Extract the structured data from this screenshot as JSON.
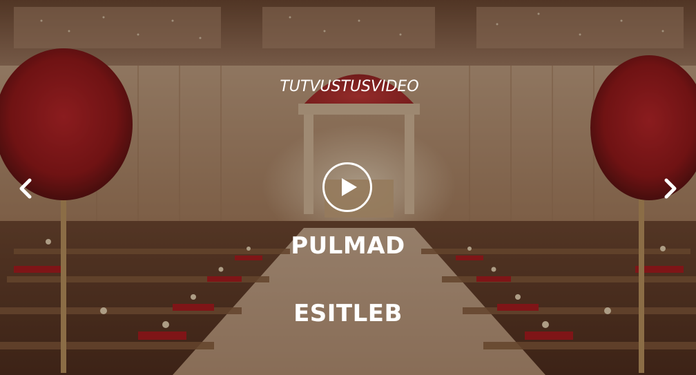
{
  "slide": {
    "eyebrow": "TUTVUSTUSVIDEO",
    "title": "PULMAD",
    "cta": "ESITLEB"
  },
  "controls": {
    "prev_icon": "chevron-left-icon",
    "next_icon": "chevron-right-icon",
    "play_icon": "play-icon"
  },
  "colors": {
    "text": "#ffffff",
    "overlay": "rgba(40,22,12,0.38)",
    "rose_red": "#b3141c",
    "drape_cream": "#e9d3b3"
  }
}
